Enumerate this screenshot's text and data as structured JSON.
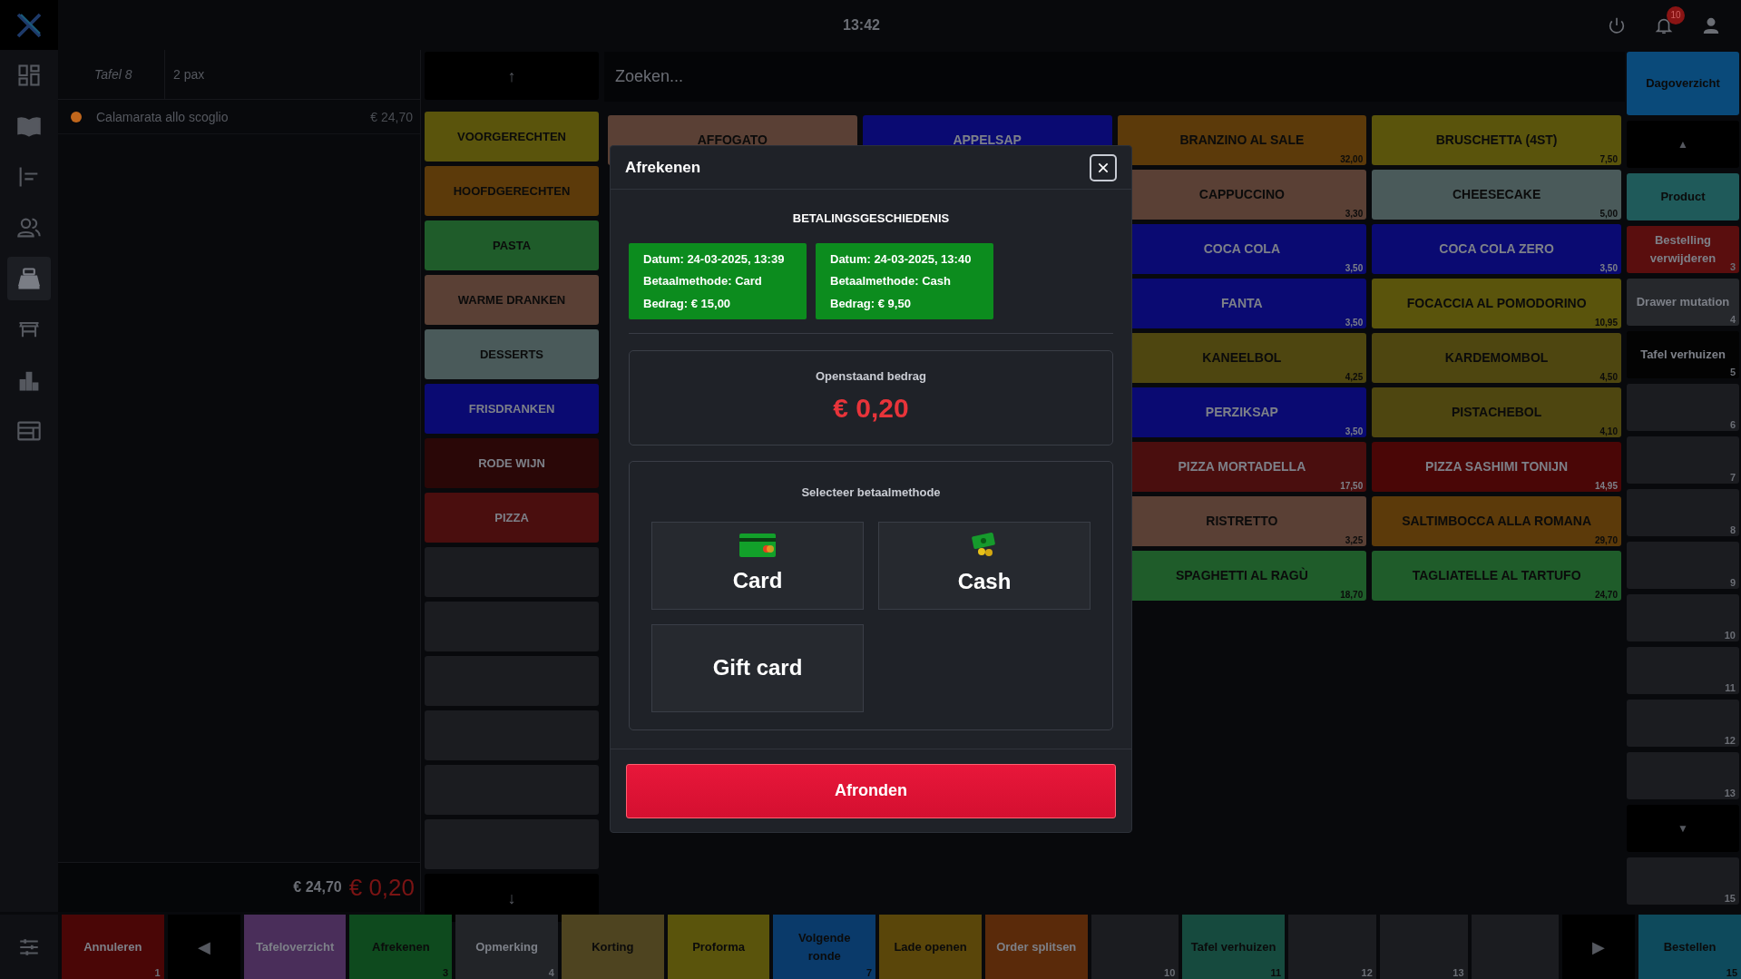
{
  "top_bar": {
    "time": "13:42",
    "notification_count": "10"
  },
  "sidebar": {
    "items": [
      {
        "selected": false
      },
      {
        "selected": false
      },
      {
        "selected": false
      },
      {
        "selected": false
      },
      {
        "selected": true
      },
      {
        "selected": false
      },
      {
        "selected": false
      },
      {
        "selected": false
      }
    ]
  },
  "order": {
    "table": "Tafel 8",
    "guests": "2 pax",
    "items": [
      {
        "name": "Calamarata allo scoglio",
        "price": "€ 24,70",
        "color": "#c0661c"
      }
    ],
    "total": "€ 24,70",
    "outstanding": "€ 0,20"
  },
  "categories": [
    {
      "kind": "arrow",
      "label": "↑"
    },
    {
      "kind": "button",
      "label": "VOORGERECHTEN",
      "color": "#5a540c"
    },
    {
      "kind": "button",
      "label": "HOOFDGERECHTEN",
      "color": "#5c3a0a"
    },
    {
      "kind": "button",
      "label": "PASTA",
      "color": "#1f5c2a"
    },
    {
      "kind": "button",
      "label": "WARME DRANKEN",
      "color": "#5a4035"
    },
    {
      "kind": "button",
      "label": "DESSERTS",
      "color": "#4a5a5a"
    },
    {
      "kind": "button",
      "label": "FRISDRANKEN",
      "color": "#0a0a72"
    },
    {
      "kind": "button",
      "label": "RODE WIJN",
      "color": "#2a0707"
    },
    {
      "kind": "button",
      "label": "PIZZA",
      "color": "#4a0e0e"
    },
    {
      "kind": "empty"
    },
    {
      "kind": "empty"
    },
    {
      "kind": "empty"
    },
    {
      "kind": "empty"
    },
    {
      "kind": "empty"
    },
    {
      "kind": "empty"
    },
    {
      "kind": "arrow",
      "label": "↓"
    }
  ],
  "search": {
    "placeholder": "Zoeken..."
  },
  "product_columns": [
    [
      {
        "name": "AFFOGATO",
        "color": "#5a4035"
      }
    ],
    [
      {
        "name": "APPELSAP",
        "color": "#0a0a72"
      }
    ],
    [
      {
        "name": "BRANZINO AL SALE",
        "price": "32,00",
        "color": "#5c3a0a"
      },
      {
        "name": "CAPPUCCINO",
        "price": "3,30",
        "color": "#5a4035"
      },
      {
        "name": "COCA COLA",
        "price": "3,50",
        "color": "#0a0a72"
      },
      {
        "name": "FANTA",
        "price": "3,50",
        "color": "#0a0a72"
      },
      {
        "name": "KANEELBOL",
        "price": "4,25",
        "color": "#4e4610"
      },
      {
        "name": "PERZIKSAP",
        "price": "3,50",
        "color": "#0a0a72"
      },
      {
        "name": "PIZZA MORTADELLA",
        "price": "17,50",
        "color": "#4a0e0e"
      },
      {
        "name": "RISTRETTO",
        "price": "3,25",
        "color": "#5a4035"
      },
      {
        "name": "SPAGHETTI AL RAGÙ",
        "price": "18,70",
        "color": "#1f5c2a"
      }
    ],
    [
      {
        "name": "BRUSCHETTA (4ST)",
        "price": "7,50",
        "color": "#5a540c"
      },
      {
        "name": "CHEESECAKE",
        "price": "5,00",
        "color": "#4a5a5a"
      },
      {
        "name": "COCA COLA ZERO",
        "price": "3,50",
        "color": "#0a0a72"
      },
      {
        "name": "FOCACCIA AL POMODORINO",
        "price": "10,95",
        "color": "#5a540c"
      },
      {
        "name": "KARDEMOMBOL",
        "price": "4,50",
        "color": "#4e4610"
      },
      {
        "name": "PISTACHEBOL",
        "price": "4,10",
        "color": "#4e4610"
      },
      {
        "name": "PIZZA SASHIMI TONIJN",
        "price": "14,95",
        "color": "#4a0606"
      },
      {
        "name": "SALTIMBOCCA ALLA ROMANA",
        "price": "29,70",
        "color": "#5c3a0a"
      },
      {
        "name": "TAGLIATELLE AL TARTUFO",
        "price": "24,70",
        "color": "#1f5c2a"
      }
    ]
  ],
  "side_actions": [
    {
      "kind": "button",
      "label": "Dagoverzicht",
      "color": "#0a4a7a"
    },
    {
      "kind": "arrow",
      "label": "▲"
    },
    {
      "kind": "button",
      "label": "Product",
      "color": "#1f5a5a"
    },
    {
      "kind": "button",
      "label": "Bestelling verwijderen",
      "color": "#5a0e0e",
      "key": "3"
    },
    {
      "kind": "button",
      "label": "Drawer mutation",
      "color": "#26282c",
      "key": "4"
    },
    {
      "kind": "button",
      "label": "Tafel verhuizen",
      "color": "#030303",
      "key": "5"
    },
    {
      "kind": "empty",
      "key": "6"
    },
    {
      "kind": "empty",
      "key": "7"
    },
    {
      "kind": "empty",
      "key": "8"
    },
    {
      "kind": "empty",
      "key": "9"
    },
    {
      "kind": "empty",
      "key": "10"
    },
    {
      "kind": "empty",
      "key": "11"
    },
    {
      "kind": "empty",
      "key": "12"
    },
    {
      "kind": "empty",
      "key": "13"
    },
    {
      "kind": "arrow",
      "label": "▼"
    },
    {
      "kind": "empty",
      "key": "15"
    }
  ],
  "bottom_bar": [
    {
      "kind": "button",
      "label": "Annuleren",
      "color": "#4a0606",
      "key": "1"
    },
    {
      "kind": "arrow",
      "label": "◀"
    },
    {
      "kind": "button",
      "label": "Tafeloverzicht",
      "color": "#4a2e5a"
    },
    {
      "kind": "button",
      "label": "Afrekenen",
      "color": "#0e4a1e",
      "key": "3"
    },
    {
      "kind": "button",
      "label": "Opmerking",
      "color": "#222428",
      "key": "4"
    },
    {
      "kind": "button",
      "label": "Korting",
      "color": "#4e4420"
    },
    {
      "kind": "button",
      "label": "Proforma",
      "color": "#5a540c"
    },
    {
      "kind": "button",
      "label": "Volgende ronde",
      "color": "#0a3a6a",
      "key": "7"
    },
    {
      "kind": "button",
      "label": "Lade openen",
      "color": "#5a460a"
    },
    {
      "kind": "button",
      "label": "Order splitsen",
      "color": "#5a2a0a"
    },
    {
      "kind": "empty",
      "key": "10"
    },
    {
      "kind": "button",
      "label": "Tafel verhuizen",
      "color": "#164a3e",
      "key": "11"
    },
    {
      "kind": "empty",
      "key": "12"
    },
    {
      "kind": "empty",
      "key": "13"
    },
    {
      "kind": "empty"
    },
    {
      "kind": "arrow",
      "label": "▶"
    },
    {
      "kind": "button",
      "label": "Bestellen",
      "color": "#0e4a5c",
      "key": "15"
    }
  ],
  "dialog": {
    "title": "Afrekenen",
    "history_title": "BETALINGSGESCHIEDENIS",
    "payments": [
      {
        "lines": [
          "Datum: 24-03-2025, 13:39",
          "Betaalmethode: Card",
          "Bedrag: € 15,00"
        ]
      },
      {
        "lines": [
          "Datum: 24-03-2025, 13:40",
          "Betaalmethode: Cash",
          "Bedrag: € 9,50"
        ]
      }
    ],
    "outstanding_label": "Openstaand bedrag",
    "outstanding_amount": "€ 0,20",
    "method_title": "Selecteer betaalmethode",
    "methods": [
      {
        "kind": "card",
        "label": "Card"
      },
      {
        "kind": "cash",
        "label": "Cash"
      },
      {
        "kind": "giftcard",
        "label": "Gift card"
      }
    ],
    "confirm": "Afronden"
  }
}
